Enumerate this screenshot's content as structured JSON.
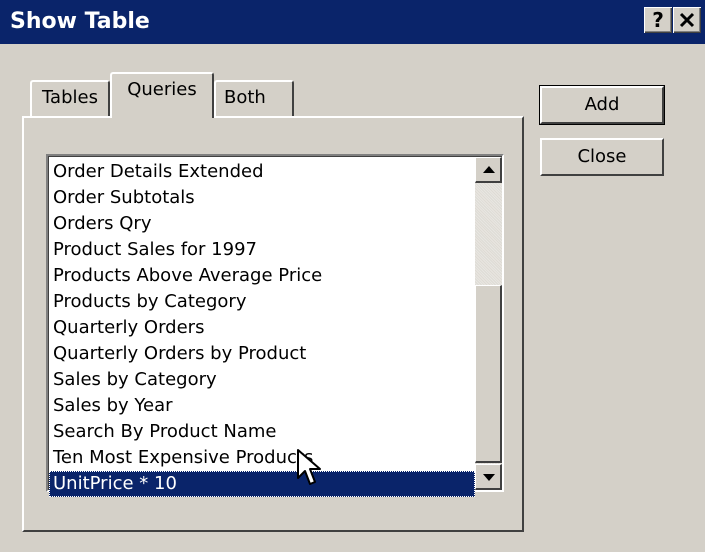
{
  "window": {
    "title": "Show Table",
    "help_label": "?",
    "close_label": "✕"
  },
  "tabs": [
    {
      "label": "Tables",
      "active": false
    },
    {
      "label": "Queries",
      "active": true
    },
    {
      "label": "Both",
      "active": false
    }
  ],
  "list": {
    "items": [
      "Order Details Extended",
      "Order Subtotals",
      "Orders Qry",
      "Product Sales for 1997",
      "Products Above Average Price",
      "Products by Category",
      "Quarterly Orders",
      "Quarterly Orders by Product",
      "Sales by Category",
      "Sales by Year",
      "Search By Product Name",
      "Ten Most Expensive Products",
      "UnitPrice * 10"
    ],
    "selected": "UnitPrice * 10"
  },
  "buttons": {
    "add_label": "Add",
    "close_label": "Close"
  },
  "icons": {
    "scroll_up": "arrow-up-icon",
    "scroll_down": "arrow-down-icon",
    "cursor": "mouse-pointer-icon"
  },
  "colors": {
    "titlebar": "#0a246a",
    "face": "#d4d0c8",
    "selection": "#0a246a"
  }
}
